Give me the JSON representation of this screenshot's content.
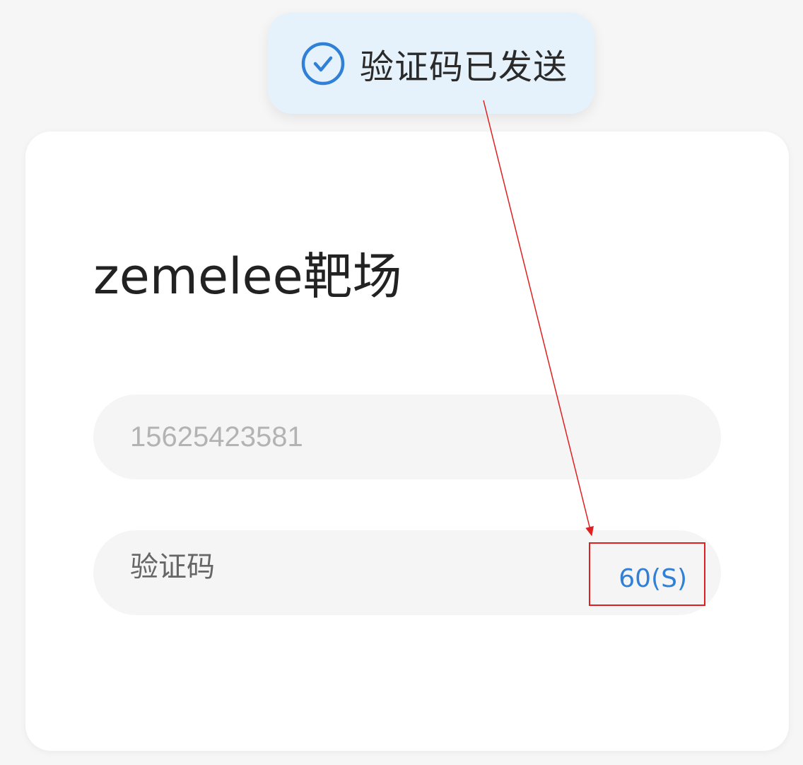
{
  "toast": {
    "icon": "check-circle-icon",
    "message": "验证码已发送"
  },
  "card": {
    "title": "zemelee靶场"
  },
  "phone_field": {
    "value": "15625423581"
  },
  "code_field": {
    "placeholder": "验证码",
    "countdown": "60(S)"
  },
  "colors": {
    "accent": "#2f80d6",
    "toast_background": "#e6f2fb",
    "annotation": "#e02020"
  }
}
